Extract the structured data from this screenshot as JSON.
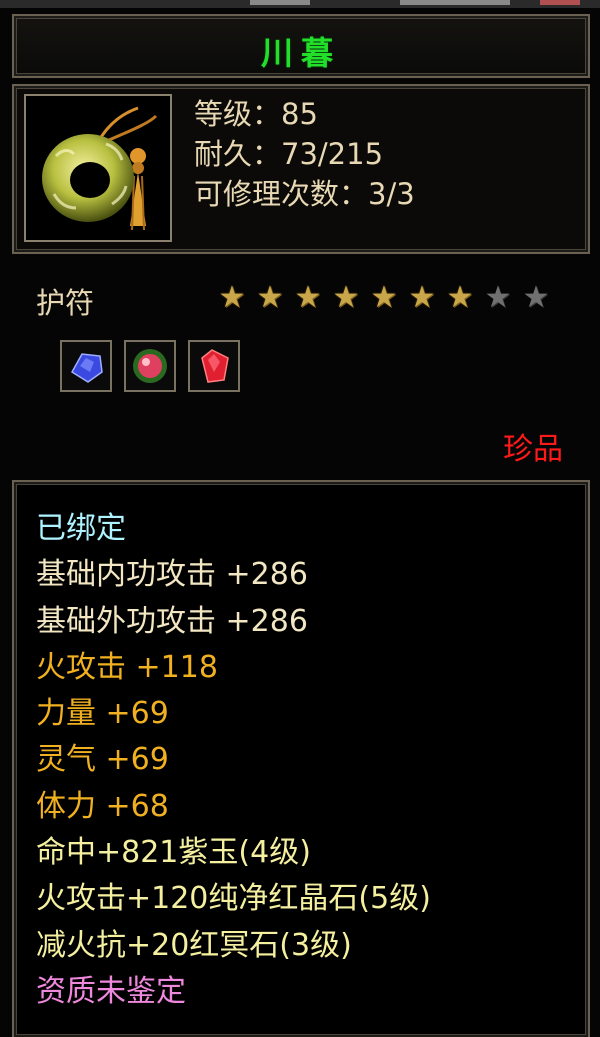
{
  "item": {
    "name": "川暮",
    "level": "等级：85",
    "durability": "耐久：73/215",
    "repair_count": "可修理次数：3/3",
    "type": "护符",
    "stars_total": 9,
    "stars_lit": 7,
    "quality": "珍品",
    "icon": "jade-ring-amulet-icon"
  },
  "gems": [
    {
      "icon": "blue-sapphire-gem-icon",
      "color": "#3a4ae0"
    },
    {
      "icon": "green-red-orb-gem-icon",
      "color": "#e04060"
    },
    {
      "icon": "red-crystal-gem-icon",
      "color": "#e02030"
    }
  ],
  "attributes": [
    {
      "text": "已绑定",
      "style": "cyan"
    },
    {
      "text": "基础内功攻击  +286",
      "style": "cream"
    },
    {
      "text": "基础外功攻击  +286",
      "style": "cream"
    },
    {
      "text": "火攻击  +118",
      "style": "gold"
    },
    {
      "text": "力量  +69",
      "style": "gold"
    },
    {
      "text": "灵气  +69",
      "style": "gold"
    },
    {
      "text": "体力  +68",
      "style": "gold"
    },
    {
      "text": "命中+821紫玉(4级)",
      "style": "yellow"
    },
    {
      "text": "火攻击+120纯净红晶石(5级)",
      "style": "yellow"
    },
    {
      "text": "减火抗+20红冥石(3级)",
      "style": "yellow"
    },
    {
      "text": "资质未鉴定",
      "style": "pink"
    }
  ],
  "colors": {
    "title": "#22e02a",
    "quality": "#ff1a1a",
    "frame": "#6a6153"
  }
}
